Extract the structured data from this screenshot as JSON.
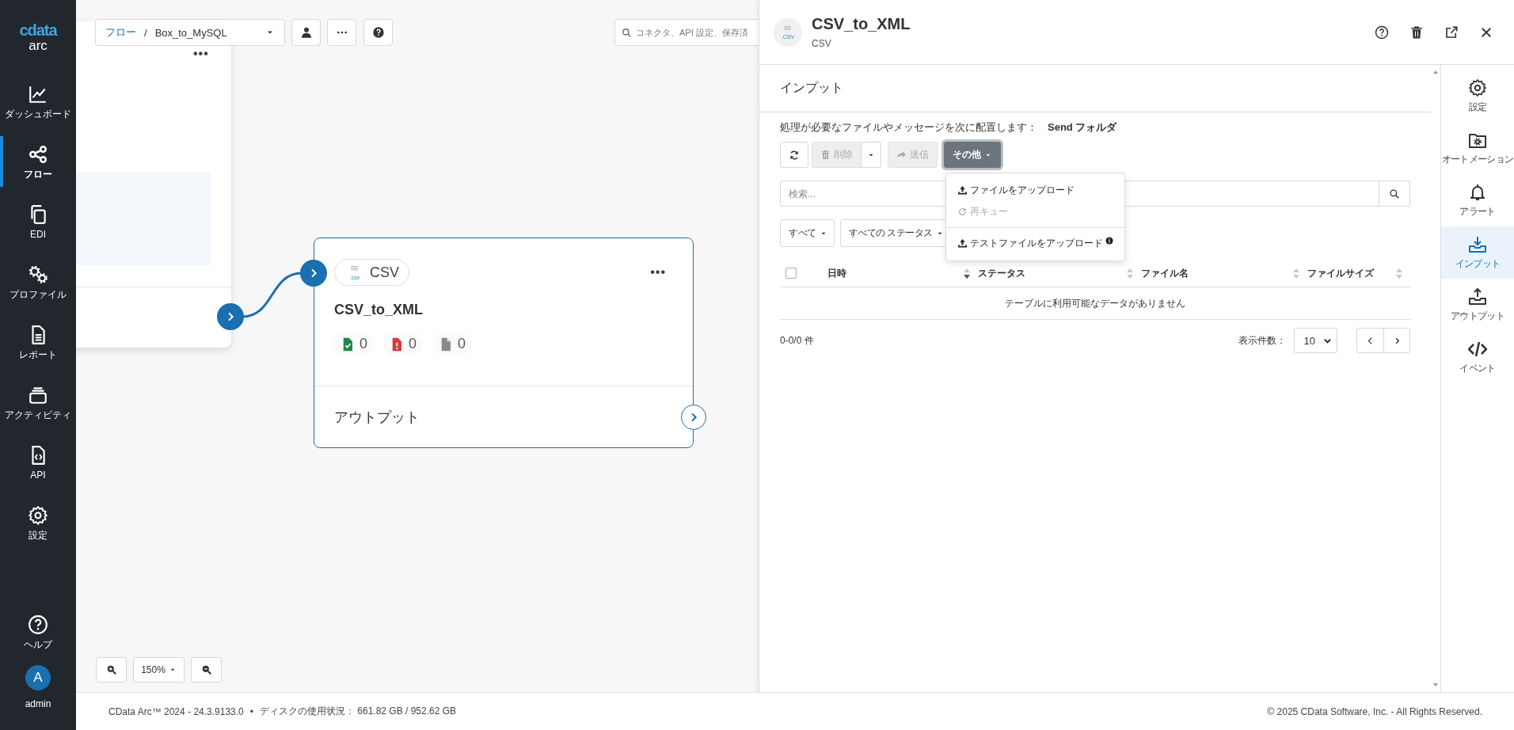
{
  "sidebar": {
    "logo": "cdata",
    "product": "arc",
    "items": [
      {
        "label": "ダッシュボード",
        "selected": false
      },
      {
        "label": "フロー",
        "selected": true
      },
      {
        "label": "EDI",
        "selected": false
      },
      {
        "label": "プロファイル",
        "selected": false
      },
      {
        "label": "レポート",
        "selected": false
      },
      {
        "label": "アクティビティ",
        "selected": false
      },
      {
        "label": "API",
        "selected": false
      },
      {
        "label": "設定",
        "selected": false
      }
    ],
    "help": {
      "label": "ヘルプ"
    },
    "user": {
      "initial": "A",
      "name": "admin"
    }
  },
  "canvas": {
    "breadcrumb": {
      "root": "フロー",
      "separator": "/",
      "flow": "Box_to_MySQL"
    },
    "search": {
      "placeholder": "コネクタ、API 設定、保存済"
    },
    "previous_node": {
      "menu": "•••"
    },
    "node": {
      "icon_text": ".csv",
      "badge": "CSV",
      "title": "CSV_to_XML",
      "menu": "•••",
      "counts": [
        {
          "kind": "success",
          "count": "0"
        },
        {
          "kind": "error",
          "count": "0"
        },
        {
          "kind": "pending",
          "count": "0"
        }
      ],
      "output_label": "アウトプット"
    },
    "zoom": {
      "label": "150%"
    }
  },
  "panel": {
    "icon_text": ".CSV",
    "title": "CSV_to_XML",
    "subtitle": "CSV",
    "section_title": "インプット",
    "description": "処理が必要なファイルやメッセージを次に配置します：　**Send フォルダ**",
    "toolbar": [
      {
        "kind": "refresh",
        "disabled": false
      },
      {
        "kind": "delete",
        "label": "削除",
        "disabled": true
      },
      {
        "kind": "send",
        "label": "送信",
        "disabled": true
      },
      {
        "kind": "more",
        "label": "その他",
        "expanded": true
      }
    ],
    "menu": [
      {
        "kind": "upload",
        "label": "ファイルをアップロード",
        "disabled": false,
        "info": false
      },
      {
        "kind": "requeue",
        "label": "再キュー",
        "disabled": true,
        "info": false
      },
      {
        "kind": "divider"
      },
      {
        "kind": "upload",
        "label": "テストファイルをアップロード",
        "disabled": false,
        "info": true
      }
    ],
    "search": {
      "placeholder": "検索..."
    },
    "filters": [
      "すべて",
      "すべての ステータス"
    ],
    "table": {
      "select_all": {
        "checked": false
      },
      "columns": [
        {
          "label": "日時",
          "sorted": true
        },
        {
          "label": "ステータス",
          "sorted": false
        },
        {
          "label": "ファイル名",
          "sorted": false
        },
        {
          "label": "ファイルサイズ",
          "sorted": false
        }
      ],
      "empty": "テーブルに利用可能なデータがありません"
    },
    "summary": "0-0/0 件",
    "page_size_label": "表示件数：",
    "page_size": "10"
  },
  "rail": [
    {
      "label": "設定",
      "selected": false
    },
    {
      "label": "オートメーション",
      "selected": false
    },
    {
      "label": "アラート",
      "selected": false
    },
    {
      "label": "インプット",
      "selected": true
    },
    {
      "label": "アウトプット",
      "selected": false
    },
    {
      "label": "イベント",
      "selected": false
    }
  ],
  "footer": {
    "version": "CData Arc™ 2024 - 24.3.9133.0",
    "bullet": "•",
    "disk": "ディスクの使用状況： 661.82 GB / 952.62 GB",
    "copyright": "© 2025 CData Software, Inc. - All Rights Reserved."
  }
}
